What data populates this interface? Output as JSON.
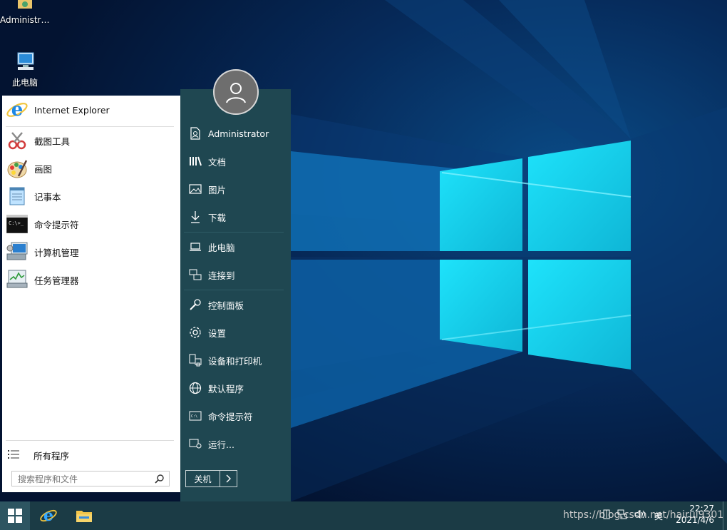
{
  "desktop": {
    "icons": [
      {
        "label": "Administra...",
        "icon": "user-folder-icon"
      },
      {
        "label": "此电脑",
        "icon": "computer-icon"
      }
    ]
  },
  "start_menu": {
    "programs": [
      {
        "label": "Internet Explorer",
        "icon": "internet-explorer-icon"
      },
      {
        "label": "截图工具",
        "icon": "snipping-tool-icon"
      },
      {
        "label": "画图",
        "icon": "paint-icon"
      },
      {
        "label": "记事本",
        "icon": "notepad-icon"
      },
      {
        "label": "命令提示符",
        "icon": "command-prompt-icon"
      },
      {
        "label": "计算机管理",
        "icon": "computer-management-icon"
      },
      {
        "label": "任务管理器",
        "icon": "task-manager-icon"
      }
    ],
    "all_programs_label": "所有程序",
    "search_placeholder": "搜索程序和文件",
    "right_items": [
      {
        "label": "Administrator",
        "icon": "user-document-icon"
      },
      {
        "label": "文档",
        "icon": "library-icon"
      },
      {
        "label": "图片",
        "icon": "picture-icon"
      },
      {
        "label": "下载",
        "icon": "download-icon"
      },
      {
        "label": "此电脑",
        "icon": "laptop-icon"
      },
      {
        "label": "连接到",
        "icon": "network-icon"
      },
      {
        "label": "控制面板",
        "icon": "wrench-icon"
      },
      {
        "label": "设置",
        "icon": "gear-icon"
      },
      {
        "label": "设备和打印机",
        "icon": "printer-icon"
      },
      {
        "label": "默认程序",
        "icon": "globe-icon"
      },
      {
        "label": "命令提示符",
        "icon": "cmd-icon"
      },
      {
        "label": "运行...",
        "icon": "run-icon"
      }
    ],
    "shutdown_label": "关机"
  },
  "taskbar": {
    "watermark": "https://blog.csdn.net/hairui9301",
    "ime": "英",
    "time": "22:27",
    "date": "2021/4/6"
  },
  "colors": {
    "right_pane": "#1f4751",
    "taskbar": "#1b3b45",
    "window_glow": "#14d6f2"
  }
}
